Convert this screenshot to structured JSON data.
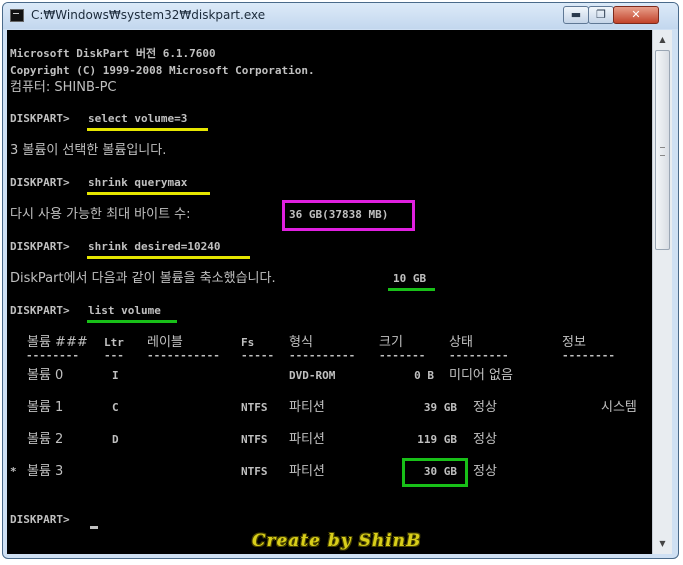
{
  "window": {
    "title": "C:₩Windows₩system32₩diskpart.exe",
    "min_label": "▬",
    "max_label": "❐",
    "close_label": "✕"
  },
  "console": {
    "header": [
      "Microsoft DiskPart 버전 6.1.7600",
      "Copyright (C) 1999-2008 Microsoft Corporation.",
      "컴퓨터: SHINB-PC"
    ],
    "prompt": "DISKPART>",
    "cmd1": "select volume=3",
    "out1": "3 볼륨이 선택한 볼륨입니다.",
    "cmd2": "shrink querymax",
    "out2": "다시 사용 가능한 최대 바이트 수:",
    "out2_value": "36 GB(37838 MB)",
    "cmd3": "shrink desired=10240",
    "out3": "DiskPart에서 다음과 같이 볼륨을 축소했습니다.",
    "out3_value": "10 GB",
    "cmd4": "list volume",
    "table": {
      "headers": [
        "볼륨 ###",
        "Ltr",
        "레이블",
        "Fs",
        "형식",
        "크기",
        "상태",
        "정보"
      ],
      "separators": [
        "--------",
        "---",
        "-----------",
        "-----",
        "----------",
        "-------",
        "---------",
        "--------"
      ],
      "rows": [
        {
          "marker": "",
          "volume": "볼륨 0",
          "ltr": "I",
          "label": "",
          "fs": "",
          "type": "DVD-ROM",
          "size": "0 B",
          "status": "미디어 없음",
          "info": ""
        },
        {
          "marker": "",
          "volume": "볼륨 1",
          "ltr": "C",
          "label": "",
          "fs": "NTFS",
          "type": "파티션",
          "size": "39 GB",
          "status": "정상",
          "info": "시스템"
        },
        {
          "marker": "",
          "volume": "볼륨 2",
          "ltr": "D",
          "label": "",
          "fs": "NTFS",
          "type": "파티션",
          "size": "119 GB",
          "status": "정상",
          "info": ""
        },
        {
          "marker": "*",
          "volume": "볼륨 3",
          "ltr": "",
          "label": "",
          "fs": "NTFS",
          "type": "파티션",
          "size": "30 GB",
          "status": "정상",
          "info": ""
        }
      ]
    },
    "final_prompt": "DISKPART>"
  },
  "colors": {
    "command_underline": "#e6e600",
    "querymax_box": "#e020e0",
    "result_highlight": "#18c018"
  },
  "watermark": "Create by ShinB"
}
